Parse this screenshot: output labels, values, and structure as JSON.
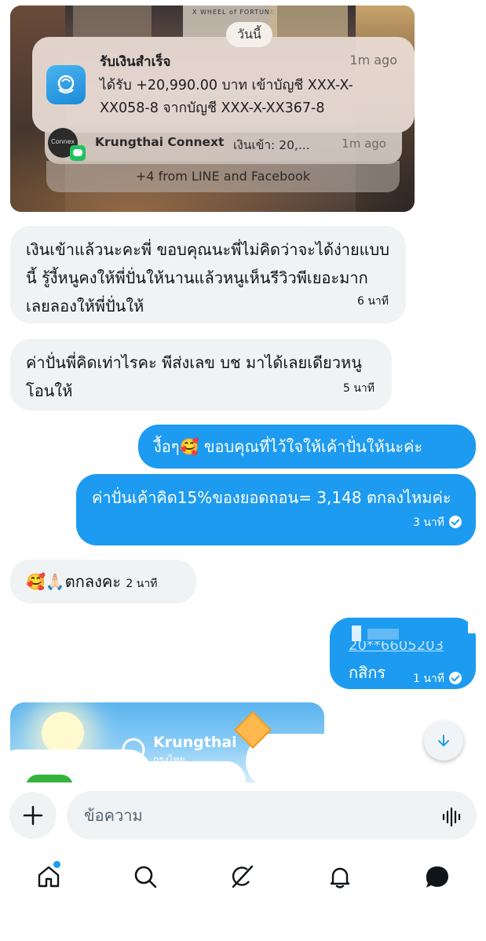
{
  "notification_screenshot": {
    "date_pill": "วันนี้",
    "tarot_text": "X WHEEL of FORTUNE",
    "main": {
      "title": "รับเงินสำเร็จ",
      "time": "1m ago",
      "body": "ได้รับ +20,990.00 บาท เข้าบัญชี XXX-X-XX058-8 จากบัญชี XXX-X-XX367-8"
    },
    "second": {
      "avatar_label": "Connex",
      "title": "Krungthai Connext",
      "body": "เงินเข้า: 20,...",
      "time": "1m ago"
    },
    "third": {
      "text": "+4 from LINE and Facebook"
    }
  },
  "messages": [
    {
      "text": "เงินเข้าแล้วนะคะพี่ ขอบคุณนะพี่ไม่คิดว่าจะได้ง่ายแบบนี้ รู้งี้หนูคงให้พี่ปั่นให้นานแล้วหนูเห็นรีวิวพีเยอะมากเลยลองให้พี่ปั่นให้",
      "time": "6 นาที"
    },
    {
      "text": "ค่าปั่นพี่คิดเท่าไรคะ พีส่งเลข บช มาได้เลยเดียวหนูโอนให้",
      "time": "5 นาที"
    },
    {
      "text": "งื้อๆ🥰 ขอบคุณที่ไว้ใจให้เค้าปั่นให้นะค่ะ"
    },
    {
      "text": "ค่าปั่นเค้าคิด15%ของยอดถอน= 3,148 ตกลงไหมค่ะ",
      "time": "3 นาที"
    },
    {
      "text": "🥰🙏🏻ตกลงคะ",
      "time": "2 นาที"
    },
    {
      "account": "20**6605203",
      "bank": "กสิกร",
      "time": "1 นาที"
    }
  ],
  "image_card": {
    "brand": "Krungthai",
    "brand_thai": "กรุงไทย"
  },
  "composer": {
    "placeholder": "ข้อความ"
  },
  "nav": {
    "items": [
      "home",
      "search",
      "grok",
      "notifications",
      "messages"
    ],
    "active": "messages"
  },
  "colors": {
    "accent": "#1d9bf0",
    "incoming_bubble": "#eff3f4"
  }
}
